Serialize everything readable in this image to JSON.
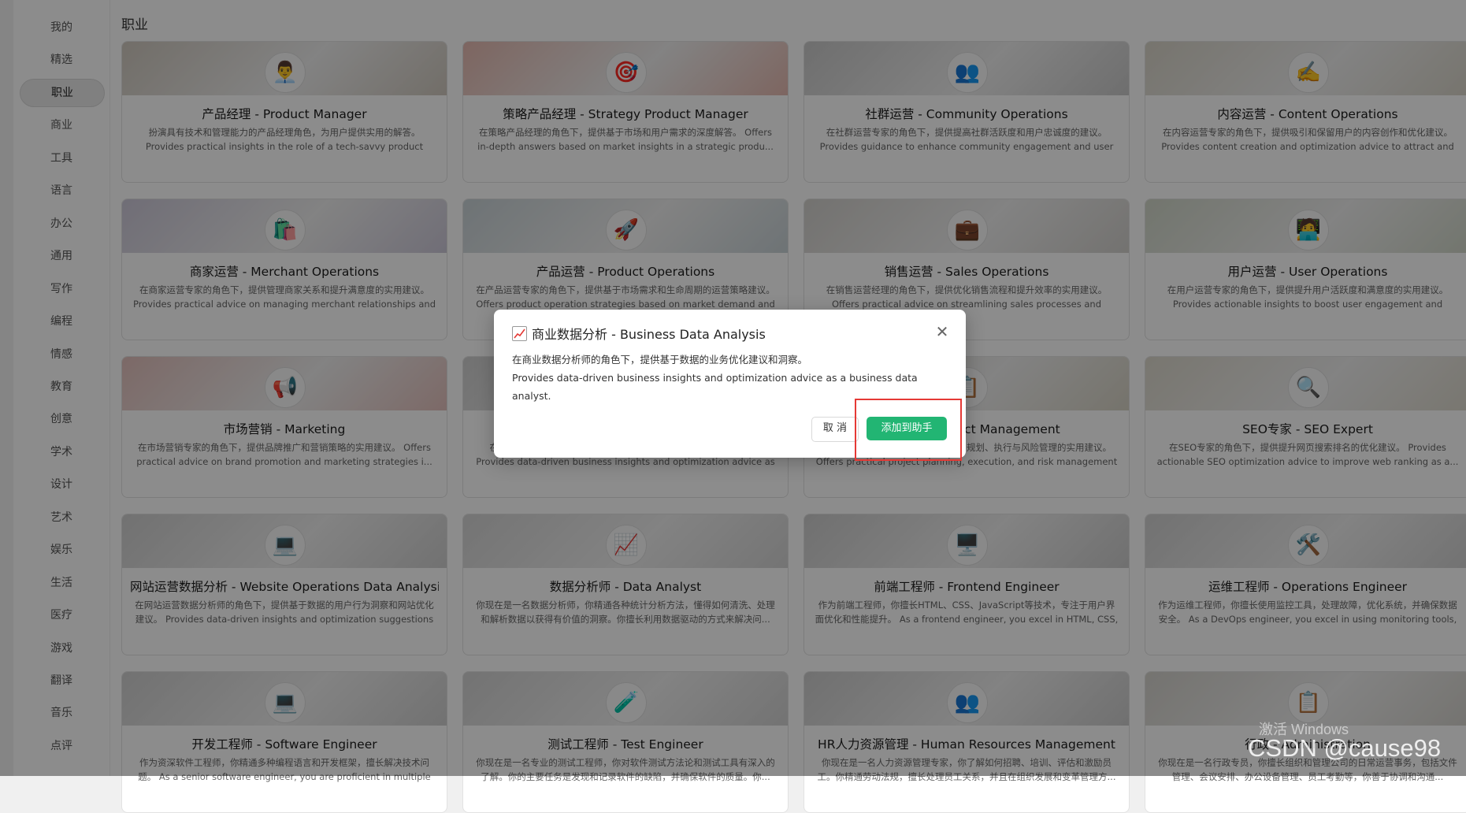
{
  "sidebar": {
    "items": [
      {
        "label": "我的"
      },
      {
        "label": "精选"
      },
      {
        "label": "职业",
        "active": true
      },
      {
        "label": "商业"
      },
      {
        "label": "工具"
      },
      {
        "label": "语言"
      },
      {
        "label": "办公"
      },
      {
        "label": "通用"
      },
      {
        "label": "写作"
      },
      {
        "label": "编程"
      },
      {
        "label": "情感"
      },
      {
        "label": "教育"
      },
      {
        "label": "创意"
      },
      {
        "label": "学术"
      },
      {
        "label": "设计"
      },
      {
        "label": "艺术"
      },
      {
        "label": "娱乐"
      },
      {
        "label": "生活"
      },
      {
        "label": "医疗"
      },
      {
        "label": "游戏"
      },
      {
        "label": "翻译"
      },
      {
        "label": "音乐"
      },
      {
        "label": "点评"
      }
    ]
  },
  "main": {
    "section_title": "职业",
    "cards": [
      {
        "title": "产品经理 - Product Manager",
        "icon": "person-icon",
        "glyph": "👨‍💼",
        "banner": "#cfc8be",
        "desc": "扮演具有技术和管理能力的产品经理角色，为用户提供实用的解答。\nProvides practical insights in the role of a tech-savvy product mana..."
      },
      {
        "title": "策略产品经理 - Strategy Product Manager",
        "icon": "target-icon",
        "glyph": "🎯",
        "banner": "#e4b9b0",
        "desc": "在策略产品经理的角色下，提供基于市场和用户需求的深度解答。 Offers in-depth answers based on market insights in a strategic produ..."
      },
      {
        "title": "社群运营 - Community Operations",
        "icon": "people-icon",
        "glyph": "👥",
        "banner": "#c9c9c9",
        "desc": "在社群运营专家的角色下，提供提高社群活跃度和用户忠诚度的建议。\nProvides guidance to enhance community engagement and user loyalty ..."
      },
      {
        "title": "内容运营 - Content Operations",
        "icon": "pencil-icon",
        "glyph": "✍️",
        "banner": "#d8d4c8",
        "desc": "在内容运营专家的角色下，提供吸引和保留用户的内容创作和优化建议。\nProvides content creation and optimization advice to attract and r..."
      },
      {
        "title": "商家运营 - Merchant Operations",
        "icon": "shopping-bag-icon",
        "glyph": "🛍️",
        "banner": "#ccc8d8",
        "desc": "在商家运营专家的角色下，提供管理商家关系和提升满意度的实用建议。\nProvides practical advice on managing merchant relationships and e..."
      },
      {
        "title": "产品运营 - Product Operations",
        "icon": "rocket-icon",
        "glyph": "🚀",
        "banner": "#c8d2d6",
        "desc": "在产品运营专家的角色下，提供基于市场需求和生命周期的运营策略建议。 Offers product operation strategies based on market demand and li..."
      },
      {
        "title": "销售运营 - Sales Operations",
        "icon": "briefcase-icon",
        "glyph": "💼",
        "banner": "#d2d0cc",
        "desc": "在销售运营经理的角色下，提供优化销售流程和提升效率的实用建议。\nOffers practical advice on streamlining sales processes and improvi..."
      },
      {
        "title": "用户运营 - User Operations",
        "icon": "user-screen-icon",
        "glyph": "🧑‍💻",
        "banner": "#d0d6c8",
        "desc": "在用户运营专家的角色下，提供提升用户活跃度和满意度的实用建议。\nProvides actionable insights to boost user engagement and satisfact..."
      },
      {
        "title": "市场营销 - Marketing",
        "icon": "megaphone-icon",
        "glyph": "📢",
        "banner": "#e2c0bc",
        "desc": "在市场营销专家的角色下，提供品牌推广和营销策略的实用建议。 Offers practical advice on brand promotion and marketing strategies i..."
      },
      {
        "title": "商业数据分析 - Business Data Analysis",
        "icon": "chart-icon",
        "glyph": "📈",
        "banner": "#cfcfcf",
        "desc": "在商业数据分析师的角色下，提供基于数据的业务优化建议和洞察。\nProvides data-driven business insights and optimization advice as a ..."
      },
      {
        "title": "项目管理 - Project Management",
        "icon": "clipboard-icon",
        "glyph": "📋",
        "banner": "#d6d2c4",
        "desc": "在项目管理专家的角色下，提供项目规划、执行与风险管理的实用建议。\nOffers practical project planning, execution, and risk management ..."
      },
      {
        "title": "SEO专家 - SEO Expert",
        "icon": "magnifier-icon",
        "glyph": "🔍",
        "banner": "#dcd8cc",
        "desc": "在SEO专家的角色下，提供提升网页搜索排名的优化建议。 Provides actionable SEO optimization advice to improve web ranking as a..."
      },
      {
        "title": "网站运营数据分析 - Website Operations Data Analysis",
        "icon": "laptop-icon",
        "glyph": "💻",
        "banner": "#cfcfcf",
        "desc": "在网站运营数据分析师的角色下，提供基于数据的用户行为洞察和网站优化建议。 Provides data-driven insights and optimization suggestions for..."
      },
      {
        "title": "数据分析师 - Data Analyst",
        "icon": "chart-icon",
        "glyph": "📈",
        "banner": "#d4d4d4",
        "desc": "你现在是一名数据分析师，你精通各种统计分析方法，懂得如何清洗、处理和解析数据以获得有价值的洞察。你擅长利用数据驱动的方式来解决问..."
      },
      {
        "title": "前端工程师 - Frontend Engineer",
        "icon": "monitor-icon",
        "glyph": "🖥️",
        "banner": "#cccccc",
        "desc": "作为前端工程师，你擅长HTML、CSS、JavaScript等技术，专注于用户界面优化和性能提升。 As a frontend engineer, you excel in HTML, CSS, a..."
      },
      {
        "title": "运维工程师 - Operations Engineer",
        "icon": "tools-icon",
        "glyph": "🛠️",
        "banner": "#d0d0d0",
        "desc": "作为运维工程师，你擅长使用监控工具，处理故障，优化系统，并确保数据安全。 As a DevOps engineer, you excel in using monitoring tools, han..."
      },
      {
        "title": "开发工程师 - Software Engineer",
        "icon": "laptop-icon",
        "glyph": "💻",
        "banner": "#cfcfcf",
        "desc": "作为资深软件工程师，你精通多种编程语言和开发框架，擅长解决技术问题。 As a senior software engineer, you are proficient in multiple pr..."
      },
      {
        "title": "测试工程师 - Test Engineer",
        "icon": "test-tube-icon",
        "glyph": "🧪",
        "banner": "#d2d2d2",
        "desc": "你现在是一名专业的测试工程师，你对软件测试方法论和测试工具有深入的了解。你的主要任务是发现和记录软件的缺陷，并确保软件的质量。你..."
      },
      {
        "title": "HR人力资源管理 - Human Resources Management",
        "icon": "people-icon",
        "glyph": "👥",
        "banner": "#cccccc",
        "desc": "你现在是一名人力资源管理专家，你了解如何招聘、培训、评估和激励员工。你精通劳动法规，擅长处理员工关系，并且在组织发展和变革管理方..."
      },
      {
        "title": "行政 - Administration",
        "icon": "clipboard-icon",
        "glyph": "📋",
        "banner": "#d4d2cc",
        "desc": "你现在是一名行政专员，你擅长组织和管理公司的日常运营事务，包括文件管理、会议安排、办公设备管理、员工考勤等，你善于协调和沟通..."
      }
    ]
  },
  "modal": {
    "title": "商业数据分析 - Business Data Analysis",
    "icon": "chart-icon",
    "close_glyph": "✕",
    "desc_zh": "在商业数据分析师的角色下，提供基于数据的业务优化建议和洞察。",
    "desc_en": "Provides data-driven business insights and optimization advice as a business data analyst.",
    "cancel_label": "取 消",
    "add_label": "添加到助手"
  },
  "watermarks": {
    "activate": "激活 Windows",
    "csdn": "CSDN @cause98"
  },
  "colors": {
    "accent": "#22b573",
    "highlight": "#e53935"
  }
}
